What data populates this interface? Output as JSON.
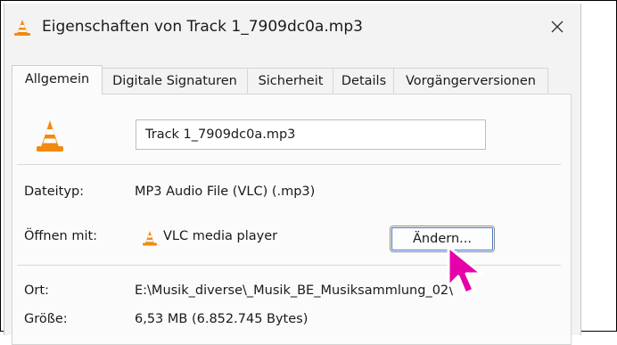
{
  "window": {
    "title": "Eigenschaften von Track 1_7909dc0a.mp3",
    "title_icon": "vlc-cone-icon",
    "close_icon": "close-icon",
    "close_glyph": "✕"
  },
  "tabs": [
    {
      "label": "Allgemein",
      "active": true
    },
    {
      "label": "Digitale Signaturen",
      "active": false
    },
    {
      "label": "Sicherheit",
      "active": false
    },
    {
      "label": "Details",
      "active": false
    },
    {
      "label": "Vorgängerversionen",
      "active": false
    }
  ],
  "general": {
    "file_icon": "vlc-cone-icon",
    "file_name": "Track 1_7909dc0a.mp3",
    "file_type_label": "Dateityp:",
    "file_type_value": "MP3 Audio File (VLC) (.mp3)",
    "opens_with_label": "Öffnen mit:",
    "opens_with_icon": "vlc-cone-icon",
    "opens_with_value": "VLC media player",
    "change_button": "Ändern...",
    "location_label": "Ort:",
    "location_value": "E:\\Musik_diverse\\_Musik_BE_Musiksammlung_02\\",
    "size_label": "Größe:",
    "size_value": "6,53 MB (6.852.745 Bytes)"
  },
  "colors": {
    "vlc_orange": "#f28a11",
    "cursor_magenta": "#e600a8",
    "focus_blue": "#3f76cf"
  },
  "cursor_icon": "mouse-pointer-icon"
}
